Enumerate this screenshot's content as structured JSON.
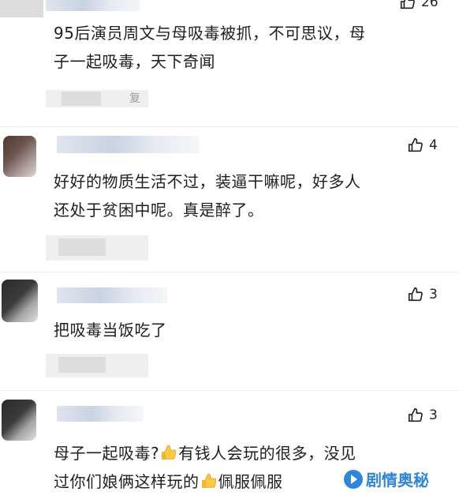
{
  "comments": [
    {
      "text": "95后演员周文与母吸毒被抓，不可思议，母子一起吸毒，天下奇闻",
      "line1": "95后演员周文与母吸毒被抓，不可思议，母",
      "line2": "子一起吸毒，天下奇闻",
      "likes": "26",
      "reply_fragment": "复"
    },
    {
      "line1": "好好的物质生活不过，装逼干嘛呢，好多人",
      "line2": "还处于贫困中呢。真是醉了。",
      "likes": "4"
    },
    {
      "line1": "把吸毒当饭吃了",
      "likes": "3"
    },
    {
      "line1_a": "母子一起吸毒?",
      "line1_b": "有钱人会玩的很多，没见",
      "line2_a": "过你们娘俩这样玩的",
      "line2_b": "佩服佩服",
      "likes": "3"
    }
  ],
  "watermark": {
    "label": "剧情奥秘"
  },
  "colors": {
    "watermark": "#2f86d6",
    "text": "#1e1e1e"
  },
  "icons": {
    "like": "thumbs-up-icon",
    "emoji": "thumbs-up-emoji-icon",
    "brand": "play-circle-icon"
  }
}
